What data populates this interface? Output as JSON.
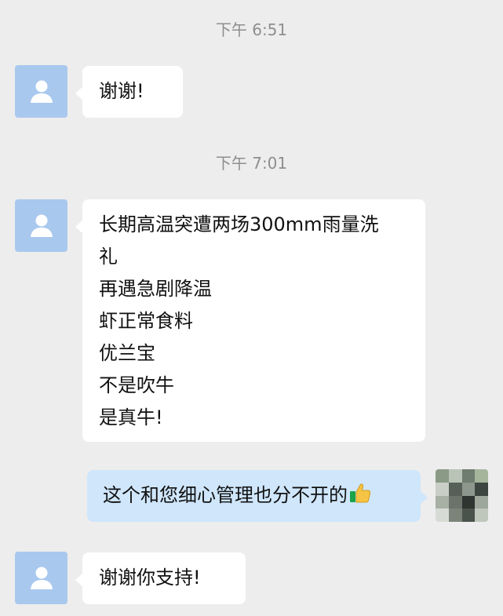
{
  "chat": {
    "messages": [
      {
        "time": "下午 6:51"
      },
      {
        "side": "left",
        "lines": [
          "谢谢!"
        ]
      },
      {
        "time": "下午 7:01"
      },
      {
        "side": "left",
        "lines": [
          "长期高温突遭两场300mm雨量洗",
          "礼",
          "再遇急剧降温",
          "虾正常食料",
          "优兰宝",
          "不是吹牛",
          "是真牛!"
        ]
      },
      {
        "side": "right",
        "lines": [
          "这个和您细心管理也分不开的"
        ],
        "emoji": "thumbs-up-icon"
      },
      {
        "side": "left",
        "lines": [
          "谢谢你支持!"
        ]
      }
    ]
  },
  "colors": {
    "background": "#ededed",
    "incoming_bubble": "#ffffff",
    "outgoing_bubble": "#cfe6fb",
    "default_avatar": "#a9c8ee",
    "timestamp_text": "#8e8e8e"
  }
}
